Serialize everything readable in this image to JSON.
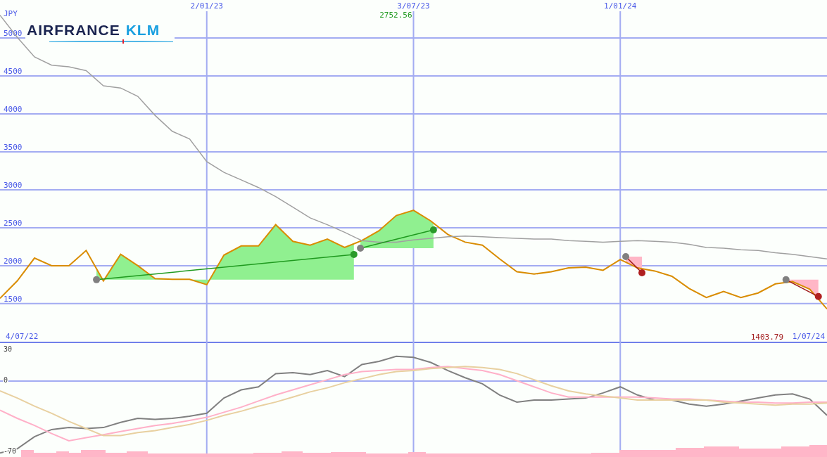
{
  "logo": {
    "word_1": "AIRFRANCE",
    "word_2": "KLM"
  },
  "price_chart": {
    "chart_data": {
      "type": "line",
      "ylabel": "JPY",
      "grid": true,
      "ylim": [
        980,
        5500
      ],
      "yticks": [
        1500,
        2000,
        2500,
        3000,
        3500,
        4000,
        4500,
        5000
      ],
      "categories": [
        null,
        null,
        null,
        null,
        null,
        null,
        null,
        null,
        null,
        null,
        null,
        null,
        "2/01/23",
        null,
        null,
        null,
        null,
        null,
        null,
        null,
        null,
        null,
        null,
        null,
        "3/07/23",
        null,
        null,
        null,
        null,
        null,
        null,
        null,
        null,
        null,
        null,
        null,
        "1/01/24",
        null,
        null,
        null,
        null,
        null,
        null,
        null,
        null,
        null,
        null,
        null,
        null
      ],
      "series": [
        {
          "color": "#d98c00",
          "values": [
            1570,
            1800,
            2100,
            2000,
            2000,
            2200,
            1800,
            2150,
            2000,
            1830,
            1820,
            1820,
            1750,
            2140,
            2260,
            2260,
            2540,
            2320,
            2270,
            2350,
            2240,
            2330,
            2460,
            2660,
            2730,
            2590,
            2410,
            2310,
            2270,
            2090,
            1920,
            1890,
            1920,
            1970,
            1980,
            1940,
            2080,
            1970,
            1930,
            1860,
            1700,
            1580,
            1660,
            1580,
            1640,
            1760,
            1790,
            1690,
            1430
          ]
        },
        {
          "color": "#a0a0a0",
          "values": [
            5300,
            5010,
            4750,
            4640,
            4620,
            4570,
            4370,
            4340,
            4230,
            3980,
            3770,
            3670,
            3370,
            3230,
            3130,
            3030,
            2910,
            2770,
            2630,
            2540,
            2440,
            2330,
            2310,
            2310,
            2340,
            2360,
            2380,
            2390,
            2380,
            2370,
            2360,
            2350,
            2350,
            2330,
            2320,
            2310,
            2320,
            2330,
            2320,
            2310,
            2280,
            2240,
            2230,
            2210,
            2200,
            2170,
            2150,
            2120,
            2090
          ]
        }
      ]
    },
    "trends": [
      {
        "kind": "up"
      },
      {
        "kind": "up"
      },
      {
        "kind": "down"
      },
      {
        "kind": "down"
      }
    ],
    "start_date": "4/07/22",
    "end_date": "1/07/24",
    "high_label": "2752.56",
    "low_label": "1403.79"
  },
  "indicator_chart": {
    "chart_data": {
      "type": "line",
      "grid": true,
      "ylim": [
        -76,
        36
      ],
      "yticks": [
        30,
        0,
        -70
      ],
      "series": [
        {
          "color": "#808080",
          "values": [
            -72,
            -68,
            -56,
            -49,
            -47,
            -48,
            -47,
            -42,
            -38,
            -39,
            -38,
            -36,
            -33,
            -18,
            -10,
            -7,
            6,
            7,
            5,
            9,
            3,
            15,
            18,
            23,
            22,
            17,
            9,
            2,
            -4,
            -15,
            -22,
            -20,
            -20,
            -19,
            -18,
            -13,
            -7,
            -15,
            -20,
            -20,
            -24,
            -26,
            -24,
            -21,
            -18,
            -15,
            -14,
            -19,
            -35
          ]
        },
        {
          "color": "#ffb0c8",
          "values": [
            -30,
            -38,
            -45,
            -53,
            -60,
            -57,
            -54,
            -51,
            -48,
            -45,
            -43,
            -40,
            -37,
            -32,
            -27,
            -21,
            -15,
            -10,
            -5,
            0,
            5,
            8,
            9,
            10,
            10,
            12,
            13,
            11,
            9,
            5,
            -1,
            -7,
            -13,
            -17,
            -17,
            -17,
            -17,
            -17,
            -18,
            -19,
            -19,
            -20,
            -21,
            -22,
            -22,
            -23,
            -23,
            -22,
            -22
          ]
        },
        {
          "color": "#e8d0a0",
          "values": [
            -11,
            -18,
            -26,
            -33,
            -41,
            -48,
            -55,
            -55,
            -52,
            -50,
            -47,
            -44,
            -40,
            -35,
            -31,
            -26,
            -22,
            -17,
            -12,
            -8,
            -3,
            1,
            5,
            8,
            9,
            11,
            12,
            13,
            12,
            10,
            6,
            0,
            -6,
            -11,
            -14,
            -16,
            -18,
            -20,
            -20,
            -20,
            -20,
            -20,
            -22,
            -23,
            -24,
            -25,
            -24,
            -24,
            -23
          ]
        }
      ]
    }
  }
}
